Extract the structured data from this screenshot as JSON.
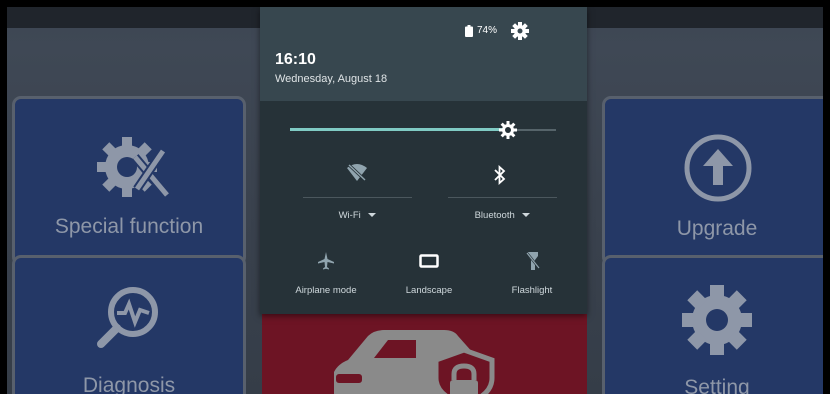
{
  "status": {
    "battery_text": "74%"
  },
  "panel": {
    "time": "16:10",
    "date": "Wednesday, August 18",
    "brightness_level": 0.82,
    "wifi_label": "Wi-Fi",
    "bluetooth_label": "Bluetooth",
    "airplane_label": "Airplane mode",
    "landscape_label": "Landscape",
    "flashlight_label": "Flashlight"
  },
  "tiles": {
    "special": "Special function",
    "diagnosis": "Diagnosis",
    "upgrade": "Upgrade",
    "setting": "Setting"
  },
  "colors": {
    "accent": "#80cbc4",
    "tile_blue": "#243866",
    "tile_red": "#6d1424"
  }
}
